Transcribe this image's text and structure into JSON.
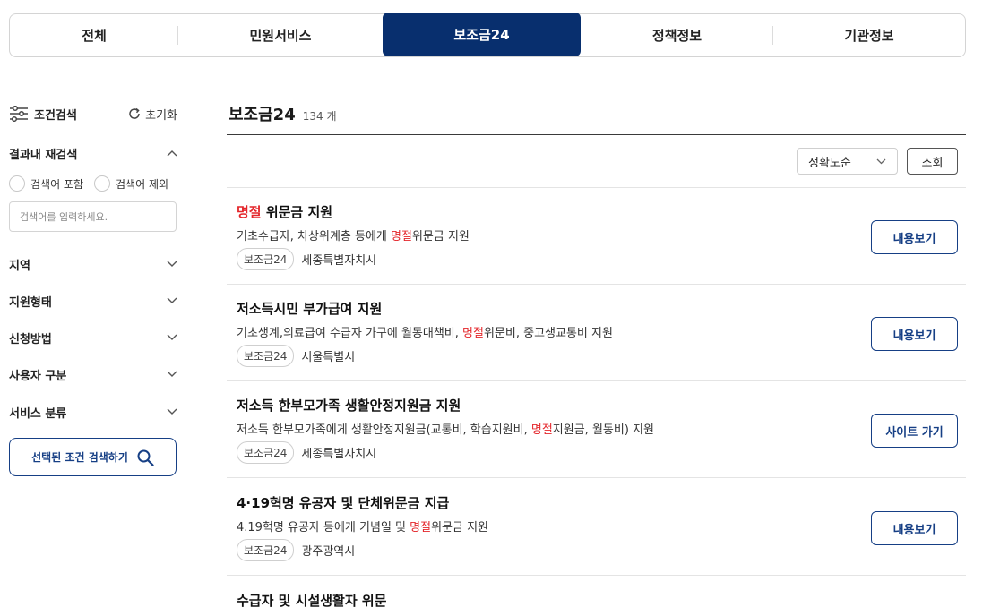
{
  "tabs": [
    {
      "label": "전체",
      "active": false
    },
    {
      "label": "민원서비스",
      "active": false
    },
    {
      "label": "보조금24",
      "active": true
    },
    {
      "label": "정책정보",
      "active": false
    },
    {
      "label": "기관정보",
      "active": false
    }
  ],
  "sidebar": {
    "title": "조건검색",
    "reset_label": "초기화",
    "research": {
      "label": "결과내 재검색",
      "include_label": "검색어 포함",
      "exclude_label": "검색어 제외",
      "placeholder": "검색어를 입력하세요."
    },
    "filters": [
      "지역",
      "지원형태",
      "신청방법",
      "사용자 구분",
      "서비스 분류"
    ],
    "search_button": "선택된 조건 검색하기"
  },
  "main": {
    "title": "보조금24",
    "count": "134 개",
    "sort_value": "정확도순",
    "query_button": "조회",
    "items": [
      {
        "name_hl": "명절",
        "name_rest": " 위문금 지원",
        "desc_before": "기초수급자, 차상위계층 등에게 ",
        "desc_hl": "명절",
        "desc_after": "위문금 지원",
        "badge": "보조금24",
        "org": "세종특별자치시",
        "action": "내용보기"
      },
      {
        "name_hl": "",
        "name_rest": "저소득시민 부가급여 지원",
        "desc_before": "기초생계,의료급여 수급자 가구에 월동대책비, ",
        "desc_hl": "명절",
        "desc_after": "위문비, 중고생교통비 지원",
        "badge": "보조금24",
        "org": "서울특별시",
        "action": "내용보기"
      },
      {
        "name_hl": "",
        "name_rest": "저소득 한부모가족 생활안정지원금 지원",
        "desc_before": "저소득 한부모가족에게 생활안정지원금(교통비, 학습지원비, ",
        "desc_hl": "명절",
        "desc_after": "지원금, 월동비) 지원",
        "badge": "보조금24",
        "org": "세종특별자치시",
        "action": "사이트 가기"
      },
      {
        "name_hl": "",
        "name_rest": "4·19혁명 유공자 및 단체위문금 지급",
        "desc_before": "4.19혁명 유공자 등에게 기념일 및 ",
        "desc_hl": "명절",
        "desc_after": "위문금 지원",
        "badge": "보조금24",
        "org": "광주광역시",
        "action": "내용보기"
      },
      {
        "name_hl": "",
        "name_rest": "수급자 및 시설생활자 위문",
        "desc_before": "",
        "desc_hl": "",
        "desc_after": "",
        "badge": "",
        "org": "",
        "action": ""
      }
    ]
  },
  "colors": {
    "brand": "#082f6e",
    "accent_button": "#163f85",
    "highlight": "#e4262b"
  }
}
